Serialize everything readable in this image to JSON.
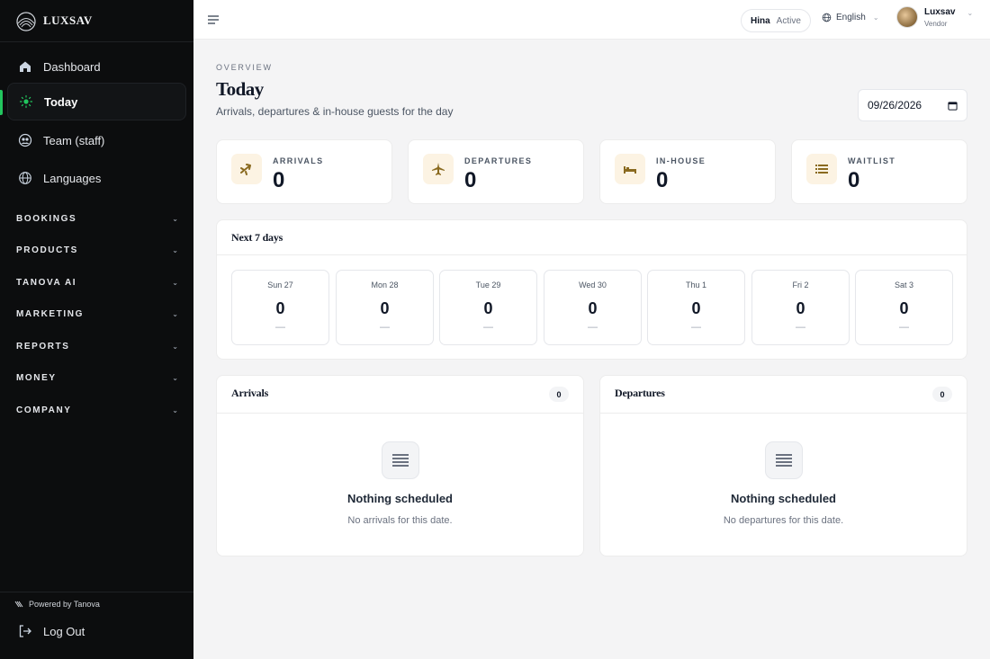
{
  "brand": {
    "name": "LUXSAV"
  },
  "sidebar": {
    "items": [
      {
        "label": "Dashboard",
        "icon": "home-icon"
      },
      {
        "label": "Today",
        "icon": "sun-icon",
        "active": true
      },
      {
        "label": "Team (staff)",
        "icon": "team-icon"
      },
      {
        "label": "Languages",
        "icon": "globe-icon"
      }
    ],
    "sections": [
      "BOOKINGS",
      "PRODUCTS",
      "TANOVA AI",
      "MARKETING",
      "REPORTS",
      "MONEY",
      "COMPANY"
    ],
    "section_chevron": "⌄",
    "powered_by": "Powered by Tanova",
    "logout": "Log Out",
    "accent_color": "#22c55e"
  },
  "header": {
    "status": {
      "name": "Hina",
      "state": "Active"
    },
    "language": "English",
    "user": {
      "name": "Luxsav",
      "role": "Vendor"
    }
  },
  "page": {
    "overline": "OVERVIEW",
    "title": "Today",
    "subtitle": "Arrivals, departures & in-house guests for the day",
    "date_value": "09/26/2026"
  },
  "stats": [
    {
      "label": "ARRIVALS",
      "value": "0",
      "icon": "plane-arrival-icon"
    },
    {
      "label": "DEPARTURES",
      "value": "0",
      "icon": "plane-departure-icon"
    },
    {
      "label": "IN-HOUSE",
      "value": "0",
      "icon": "bed-icon"
    },
    {
      "label": "WAITLIST",
      "value": "0",
      "icon": "list-icon"
    }
  ],
  "week": {
    "title": "Next 7 days",
    "days": [
      {
        "label": "Sun 27",
        "value": "0",
        "sub": "—"
      },
      {
        "label": "Mon 28",
        "value": "0",
        "sub": "—"
      },
      {
        "label": "Tue 29",
        "value": "0",
        "sub": "—"
      },
      {
        "label": "Wed 30",
        "value": "0",
        "sub": "—"
      },
      {
        "label": "Thu 1",
        "value": "0",
        "sub": "—"
      },
      {
        "label": "Fri 2",
        "value": "0",
        "sub": "—"
      },
      {
        "label": "Sat 3",
        "value": "0",
        "sub": "—"
      }
    ]
  },
  "arrivals": {
    "title": "Arrivals",
    "count": "0",
    "empty_title": "Nothing scheduled",
    "empty_sub": "No arrivals for this date."
  },
  "departures": {
    "title": "Departures",
    "count": "0",
    "empty_title": "Nothing scheduled",
    "empty_sub": "No departures for this date."
  },
  "colors": {
    "sidebar_bg": "#0c0d0e",
    "icon_tile_bg": "#fcf3e3",
    "icon_tile_fg": "#8a6a1f"
  }
}
